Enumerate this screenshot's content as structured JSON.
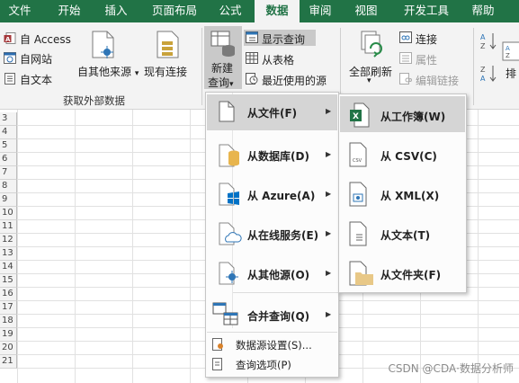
{
  "tabs": [
    {
      "label": "文件"
    },
    {
      "label": "开始"
    },
    {
      "label": "插入"
    },
    {
      "label": "页面布局"
    },
    {
      "label": "公式"
    },
    {
      "label": "数据",
      "active": true
    },
    {
      "label": "审阅"
    },
    {
      "label": "视图"
    },
    {
      "label": "开发工具"
    },
    {
      "label": "帮助"
    }
  ],
  "ribbon": {
    "external_data": {
      "access": "自 Access",
      "web": "自网站",
      "text": "自文本",
      "other_sources": "自其他来源",
      "existing_connections": "现有连接",
      "group_label": "获取外部数据"
    },
    "query": {
      "new_query_line1": "新建",
      "new_query_line2": "查询",
      "show_queries": "显示查询",
      "from_table": "从表格",
      "recent_sources": "最近使用的源"
    },
    "connections": {
      "refresh_all_line1": "全部刷新",
      "connections": "连接",
      "properties": "属性",
      "edit_links": "编辑链接"
    },
    "sort": {
      "label": "排"
    }
  },
  "rows": [
    "3",
    "4",
    "5",
    "6",
    "7",
    "8",
    "9",
    "10",
    "11",
    "12",
    "13",
    "14",
    "15",
    "16",
    "17",
    "18",
    "19",
    "20",
    "21"
  ],
  "menu": {
    "items": [
      {
        "label": "从文件(F)",
        "icon": "file-icon",
        "highlighted": true
      },
      {
        "label": "从数据库(D)",
        "icon": "database-icon"
      },
      {
        "label": "从 Azure(A)",
        "icon": "azure-icon"
      },
      {
        "label": "从在线服务(E)",
        "icon": "cloud-service-icon"
      },
      {
        "label": "从其他源(O)",
        "icon": "other-source-icon"
      },
      {
        "label": "合并查询(Q)",
        "icon": "combine-icon"
      }
    ],
    "footer": [
      {
        "label": "数据源设置(S)...",
        "icon": "data-source-settings-icon"
      },
      {
        "label": "查询选项(P)",
        "icon": "query-options-icon"
      }
    ]
  },
  "submenu": {
    "items": [
      {
        "label": "从工作簿(W)",
        "icon": "excel-workbook-icon",
        "highlighted": true
      },
      {
        "label": "从 CSV(C)",
        "icon": "csv-icon"
      },
      {
        "label": "从 XML(X)",
        "icon": "xml-icon"
      },
      {
        "label": "从文本(T)",
        "icon": "text-file-icon"
      },
      {
        "label": "从文件夹(F)",
        "icon": "folder-icon"
      }
    ]
  },
  "watermark": "CSDN @CDA·数据分析师",
  "colors": {
    "excel_green": "#217346",
    "highlight": "#d5d5d5",
    "ribbon_bg": "#f3f3f3"
  }
}
